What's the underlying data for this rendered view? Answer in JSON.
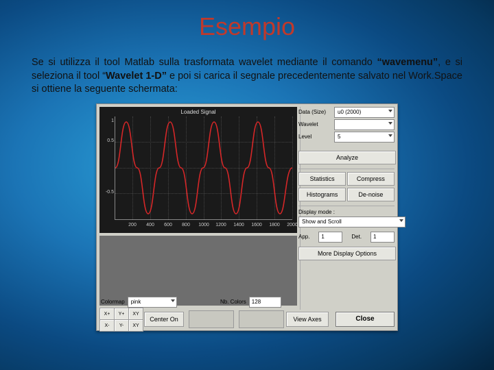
{
  "slide": {
    "title": "Esempio",
    "paragraph_parts": {
      "p1": "Se si utilizza il tool Matlab sulla trasformata wavelet mediante il comando ",
      "b1": "“wavemenu”",
      "p2": ", e si seleziona il tool “",
      "b2": "Wavelet 1-D”",
      "p3": " e poi si carica il segnale precedentemente salvato nel Work.Space si ottiene la seguente schermata:"
    }
  },
  "matlab": {
    "plot_title": "Loaded Signal",
    "yticks": [
      "0.5",
      "1",
      "-0.5"
    ],
    "xticks": [
      "200",
      "400",
      "600",
      "800",
      "1000",
      "1200",
      "1400",
      "1600",
      "1800",
      "2000"
    ],
    "sidebar": {
      "data_label": "Data (Size)",
      "data_value": "u0  (2000)",
      "wavelet_label": "Wavelet",
      "wavelet_value": "",
      "level_label": "Level",
      "level_value": "5",
      "analyze": "Analyze",
      "statistics": "Statistics",
      "compress": "Compress",
      "histograms": "Histograms",
      "denoise": "De-noise",
      "display_mode_label": "Display mode :",
      "display_mode_value": "Show and Scroll",
      "app_value": "1",
      "det_value": "1",
      "more_disp": "More Display Options"
    },
    "colormap": {
      "label": "Colormap",
      "value": "pink",
      "nb_label": "Nb. Colors",
      "nb_value": "128"
    },
    "bottom": {
      "btns": [
        "X+",
        "Y+",
        "XY",
        "X-",
        "Y-",
        "XY"
      ],
      "center_label": "Center On",
      "close": "Close",
      "view_axes": "View Axes"
    }
  },
  "chart_data": {
    "type": "line",
    "title": "Loaded Signal",
    "xlabel": "",
    "ylabel": "",
    "xlim": [
      0,
      2000
    ],
    "ylim": [
      -1,
      1
    ],
    "xticks": [
      200,
      400,
      600,
      800,
      1000,
      1200,
      1400,
      1600,
      1800,
      2000
    ],
    "yticks": [
      -0.5,
      0,
      0.5,
      1
    ],
    "series": [
      {
        "name": "u0",
        "description": "sinusoid, approx 4 full periods over x=0..2000, amplitude ≈1",
        "x_sample": [
          0,
          125,
          250,
          375,
          500,
          625,
          750,
          875,
          1000,
          1125,
          1250,
          1375,
          1500,
          1625,
          1750,
          1875,
          2000
        ],
        "y_sample": [
          0,
          1,
          0,
          -1,
          0,
          1,
          0,
          -1,
          0,
          1,
          0,
          -1,
          0,
          1,
          0,
          -1,
          0
        ]
      }
    ]
  }
}
